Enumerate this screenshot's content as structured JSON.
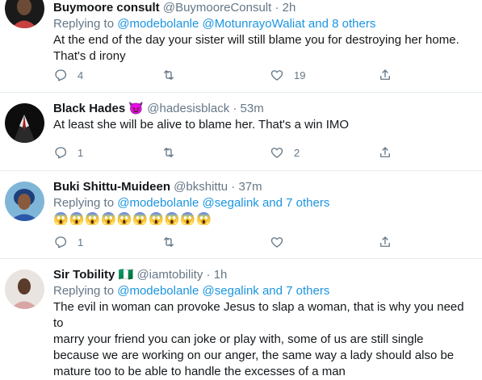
{
  "tweets": [
    {
      "name": "Buymoore consult",
      "handle": "@BuymooreConsult",
      "time": "2h",
      "replying_prefix": "",
      "mentions": [],
      "mentions_tail": "",
      "text_lines": [
        "At the end of the day your sister will still blame you for destroying her home.",
        "That's d irony"
      ],
      "reply_count": "4",
      "retweet_count": "",
      "like_count": "19"
    },
    {
      "name": "Black Hades",
      "badge": "😈",
      "handle": "@hadesisblack",
      "time": "53m",
      "text": "At least she will be alive to blame her. That's a win IMO",
      "reply_count": "1",
      "retweet_count": "",
      "like_count": "2"
    },
    {
      "name": "Buki Shittu-Muideen",
      "handle": "@bkshittu",
      "time": "37m",
      "replying_prefix": "Replying to",
      "mention_1": "@modebolanle",
      "mention_2": "@segalink",
      "mentions_tail": "and 7 others",
      "emoji": "😱😱😱😱😱😱😱😱😱😱",
      "emoji_count": 10,
      "reply_count": "1",
      "retweet_count": "",
      "like_count": ""
    },
    {
      "name": "Sir Tobility",
      "flag": "🇳🇬",
      "handle": "@iamtobility",
      "time": "1h",
      "replying_prefix": "Replying to",
      "mention_1": "@modebolanle",
      "mention_2": "@segalink",
      "mentions_tail": "and 7 others",
      "text_lines": [
        "The evil in woman can provoke Jesus to slap a woman, that is why you need to",
        "marry your friend you can joke or play with, some of us are still single",
        "because we are working on our anger, the same way a lady should also be",
        "mature too to be able to handle the excesses of a man"
      ]
    }
  ],
  "first_reply": {
    "prefix": "Replying to",
    "mention_1": "@modebolanle",
    "mention_2": "@MotunrayoWaliat",
    "tail": "and 8 others"
  },
  "separator": "·",
  "icons": [
    "reply-icon",
    "retweet-icon",
    "like-icon",
    "share-icon"
  ],
  "colors": {
    "accent": "#1b95e0",
    "muted": "#657786",
    "text": "#14171a",
    "border": "#e6ecf0"
  }
}
